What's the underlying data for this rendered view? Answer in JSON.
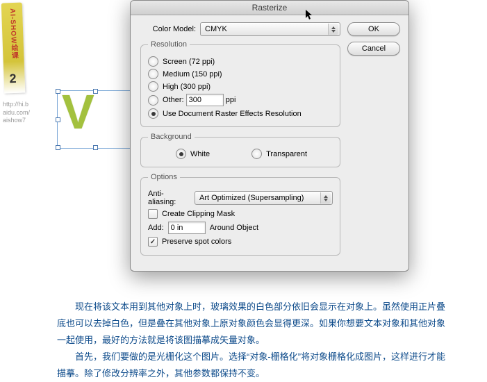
{
  "sidebar": {
    "ribbon_text": "AI-SHOW绘课",
    "ribbon_number": "2",
    "url_line1": "http://hi.b",
    "url_line2": "aidu.com/",
    "url_line3": "aishow7"
  },
  "artwork": {
    "letter": "V"
  },
  "dialog": {
    "title": "Rasterize",
    "color_model_label": "Color Model:",
    "color_model_value": "CMYK",
    "resolution": {
      "legend": "Resolution",
      "screen": "Screen (72 ppi)",
      "medium": "Medium (150 ppi)",
      "high": "High (300 ppi)",
      "other_label": "Other:",
      "other_value": "300",
      "other_unit": "ppi",
      "use_doc": "Use Document Raster Effects Resolution"
    },
    "background": {
      "legend": "Background",
      "white": "White",
      "transparent": "Transparent"
    },
    "options": {
      "legend": "Options",
      "aa_label": "Anti-aliasing:",
      "aa_value": "Art Optimized (Supersampling)",
      "clip_mask": "Create Clipping Mask",
      "add_label": "Add:",
      "add_value": "0 in",
      "around": "Around Object",
      "preserve": "Preserve spot colors"
    },
    "buttons": {
      "ok": "OK",
      "cancel": "Cancel"
    }
  },
  "body_text": {
    "p1": "现在将该文本用到其他对象上时，玻璃效果的白色部分依旧会显示在对象上。虽然使用正片叠底也可以去掉白色，但是叠在其他对象上原对象颜色会显得更深。如果你想要文本对象和其他对象一起使用，最好的方法就是将该图描摹成矢量对象。",
    "p2": "首先，我们要做的是光栅化这个图片。选择“对象-栅格化”将对象栅格化成图片，这样进行才能描摹。除了修改分辨率之外，其他参数都保持不变。"
  }
}
